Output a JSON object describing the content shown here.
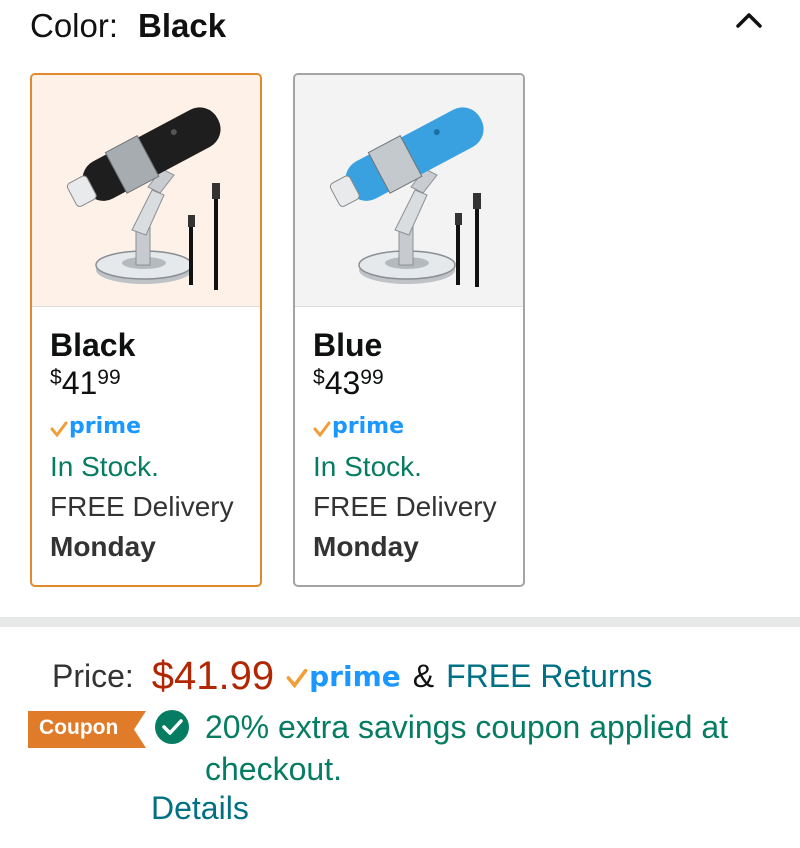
{
  "variation": {
    "label": "Color:",
    "selected": "Black",
    "collapse_icon": "chevron-up-icon"
  },
  "swatches": [
    {
      "name": "Black",
      "currency": "$",
      "whole": "41",
      "fraction": "99",
      "prime_label": "prime",
      "stock": "In Stock.",
      "delivery": "FREE Delivery",
      "day": "Monday",
      "selected": true,
      "product_color": "#1e1e1e"
    },
    {
      "name": "Blue",
      "currency": "$",
      "whole": "43",
      "fraction": "99",
      "prime_label": "prime",
      "stock": "In Stock.",
      "delivery": "FREE Delivery",
      "day": "Monday",
      "selected": false,
      "product_color": "#3aa1e0"
    }
  ],
  "price": {
    "label": "Price:",
    "value": "$41.99",
    "prime_label": "prime",
    "amp": "&",
    "returns": "FREE Returns"
  },
  "coupon": {
    "badge": "Coupon",
    "text": "20% extra savings coupon applied at checkout.",
    "details": "Details"
  },
  "colors": {
    "accent_selected": "#e18a2d",
    "price_red": "#b12704",
    "stock_green": "#067d62",
    "link_teal": "#007185",
    "prime_blue": "#1a98ff",
    "prime_check": "#f19e39",
    "coupon_orange": "#e07b2a"
  }
}
